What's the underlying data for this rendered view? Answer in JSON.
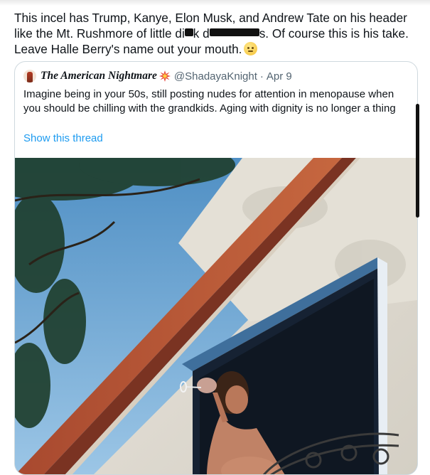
{
  "tweet": {
    "text_part1": "This incel has Trump, Kanye, Elon Musk, and Andrew Tate on his header like the Mt. Rushmore of little di",
    "text_part2": "k d",
    "text_part3": "s. Of course this is his take. Leave Halle Berry's name out your mouth.",
    "emoji_icon": "rolling-eyes-emoji"
  },
  "quoted_tweet": {
    "display_name": "The American Nightmare",
    "handle": "@ShadayaKnight",
    "separator": "·",
    "date": "Apr 9",
    "name_badge_icon": "collision-burst-emoji",
    "text": "Imagine being in your 50s, still posting nudes for attention in menopause when you should be chilling with the grandkids. Aging with dignity is no longer a thing",
    "show_thread_label": "Show this thread"
  },
  "colors": {
    "link": "#1d9bf0",
    "secondary_text": "#536471",
    "border": "#cfd9de"
  }
}
